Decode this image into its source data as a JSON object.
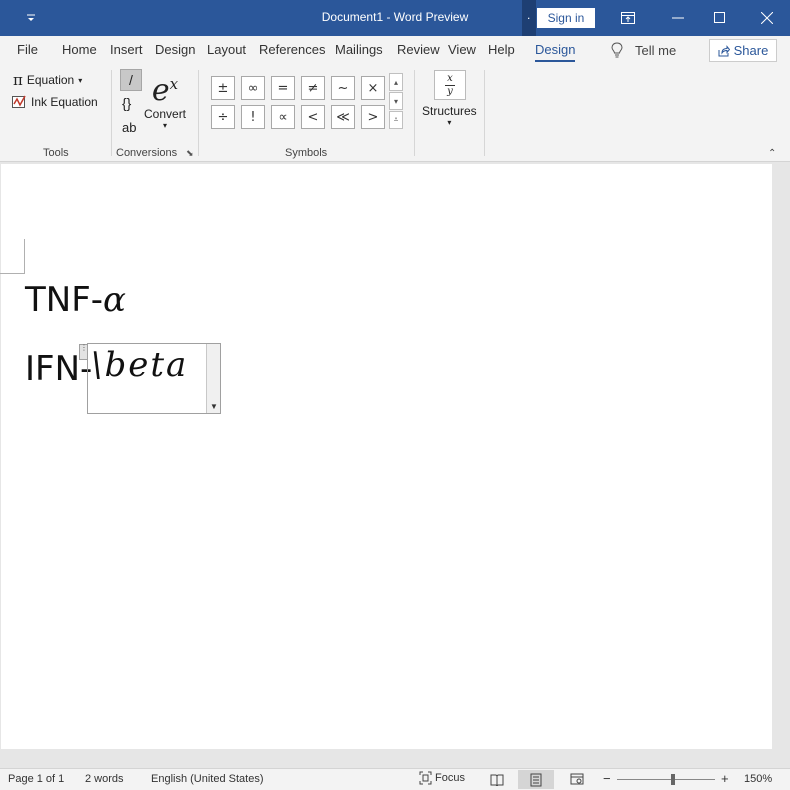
{
  "titlebar": {
    "title": "Document1  -  Word Preview",
    "signin_label": "Sign in",
    "dot_label": "."
  },
  "menu": {
    "tabs": [
      "File",
      "Home",
      "Insert",
      "Design",
      "Layout",
      "References",
      "Mailings",
      "Review",
      "View",
      "Help",
      "Design"
    ],
    "active_tab": "Design",
    "tell_me": "Tell me",
    "share": "Share"
  },
  "ribbon": {
    "tools": {
      "equation_label": "Equation",
      "ink_equation_label": "Ink Equation",
      "group_label": "Tools"
    },
    "conversions": {
      "linear_glyph": "/",
      "braces_glyph": "{}",
      "text_glyph": "ab",
      "convert_label": "Convert",
      "convert_glyph": "e",
      "convert_sup": "x",
      "group_label": "Conversions"
    },
    "symbols": {
      "row1": [
        "±",
        "∞",
        "=",
        "≠",
        "~",
        "×"
      ],
      "row2": [
        "÷",
        "!",
        "∝",
        "<",
        "≪",
        ">"
      ],
      "group_label": "Symbols"
    },
    "structures": {
      "label": "Structures",
      "icon_top": "x",
      "icon_bottom": "y"
    }
  },
  "document": {
    "line1_prefix": "TNF-",
    "line1_greek": "α",
    "line2_prefix": "IFN-",
    "equation_text": "\\beta"
  },
  "status": {
    "page": "Page 1 of 1",
    "words": "2 words",
    "language": "English (United States)",
    "focus": "Focus",
    "zoom_minus": "−",
    "zoom_plus": "+",
    "zoom": "150%",
    "zoom_percent": 150
  }
}
